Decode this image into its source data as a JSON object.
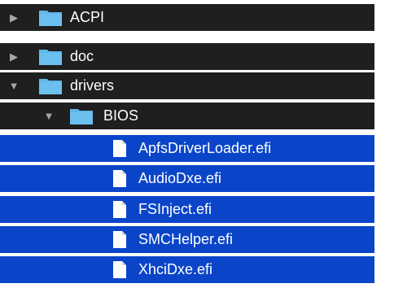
{
  "rows": [
    {
      "label": "ACPI",
      "kind": "folder",
      "disclosure": "collapsed",
      "selected": false
    },
    {
      "label": "doc",
      "kind": "folder",
      "disclosure": "collapsed",
      "selected": false
    },
    {
      "label": "drivers",
      "kind": "folder",
      "disclosure": "expanded",
      "selected": false
    },
    {
      "label": "BIOS",
      "kind": "folder",
      "disclosure": "expanded",
      "selected": false
    },
    {
      "label": "ApfsDriverLoader.efi",
      "kind": "file",
      "selected": true
    },
    {
      "label": "AudioDxe.efi",
      "kind": "file",
      "selected": true
    },
    {
      "label": "FSInject.efi",
      "kind": "file",
      "selected": true
    },
    {
      "label": "SMCHelper.efi",
      "kind": "file",
      "selected": true
    },
    {
      "label": "XhciDxe.efi",
      "kind": "file",
      "selected": true
    }
  ],
  "colors": {
    "row_dark": "#1f1f1f",
    "row_selected": "#0a45c9",
    "folder_blue": "#5fb6e8",
    "text": "#ffffff",
    "disclosure": "#a7a7a7"
  },
  "icons": {
    "collapsed": "disclosure-triangle-right-icon",
    "expanded": "disclosure-triangle-down-icon",
    "folder": "folder-icon",
    "file": "document-icon"
  }
}
